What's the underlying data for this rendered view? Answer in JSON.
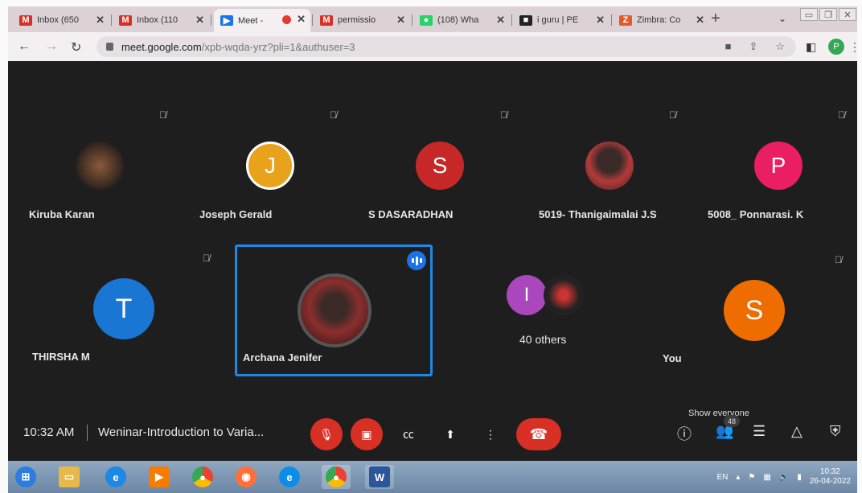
{
  "browser": {
    "tabs": [
      {
        "title": "Inbox (650",
        "icon": "gmail-icon",
        "fav": "M",
        "color": "#d93025"
      },
      {
        "title": "Inbox (110",
        "icon": "gmail-icon",
        "fav": "M",
        "color": "#d93025"
      },
      {
        "title": "Meet -",
        "icon": "meet-icon",
        "fav": "▶",
        "color": "#1a73e8",
        "active": true
      },
      {
        "title": "permissio",
        "icon": "gmail-icon",
        "fav": "M",
        "color": "#d93025"
      },
      {
        "title": "(108) Wha",
        "icon": "whatsapp-icon",
        "fav": "●",
        "color": "#25d366"
      },
      {
        "title": "i guru | PE",
        "icon": "iguru-icon",
        "fav": "■",
        "color": "#222222"
      },
      {
        "title": "Zimbra: Co",
        "icon": "zimbra-icon",
        "fav": "Z",
        "color": "#e05a2a"
      }
    ],
    "url_host": "meet.google.com",
    "url_rest": "/xpb-wqda-yrz?pli=1&authuser=3",
    "profile_initial": "P"
  },
  "participants_row1": [
    {
      "name": "Kiruba Karan",
      "type": "photo",
      "color": "#6d4c3b"
    },
    {
      "name": "Joseph Gerald",
      "type": "initial",
      "initial": "J",
      "color": "#e8a21b"
    },
    {
      "name": "S DASARADHAN",
      "type": "initial",
      "initial": "S",
      "color": "#c62828"
    },
    {
      "name": "5019- Thanigaimalai J.S",
      "type": "photo",
      "color": "#7a2b2b"
    },
    {
      "name": "5008_ Ponnarasi. K",
      "type": "initial",
      "initial": "P",
      "color": "#e91e63"
    }
  ],
  "participants_row2": [
    {
      "name": "THIRSHA M",
      "type": "initial",
      "initial": "T",
      "color": "#1976d2"
    },
    {
      "name": "Archana Jenifer",
      "type": "photo",
      "color": "#8b2e2e"
    },
    {
      "name": "40 others",
      "type": "group",
      "initial": "I",
      "color": "#ab47bc"
    },
    {
      "name": "You",
      "type": "initial",
      "initial": "S",
      "color": "#ef6c00"
    }
  ],
  "meeting": {
    "time": "10:32 AM",
    "title": "Weninar-Introduction to Varia...",
    "show_everyone": "Show everyone",
    "participant_count": "48"
  },
  "taskbar": {
    "lang": "EN",
    "time": "10:32",
    "date": "26-04-2022"
  }
}
